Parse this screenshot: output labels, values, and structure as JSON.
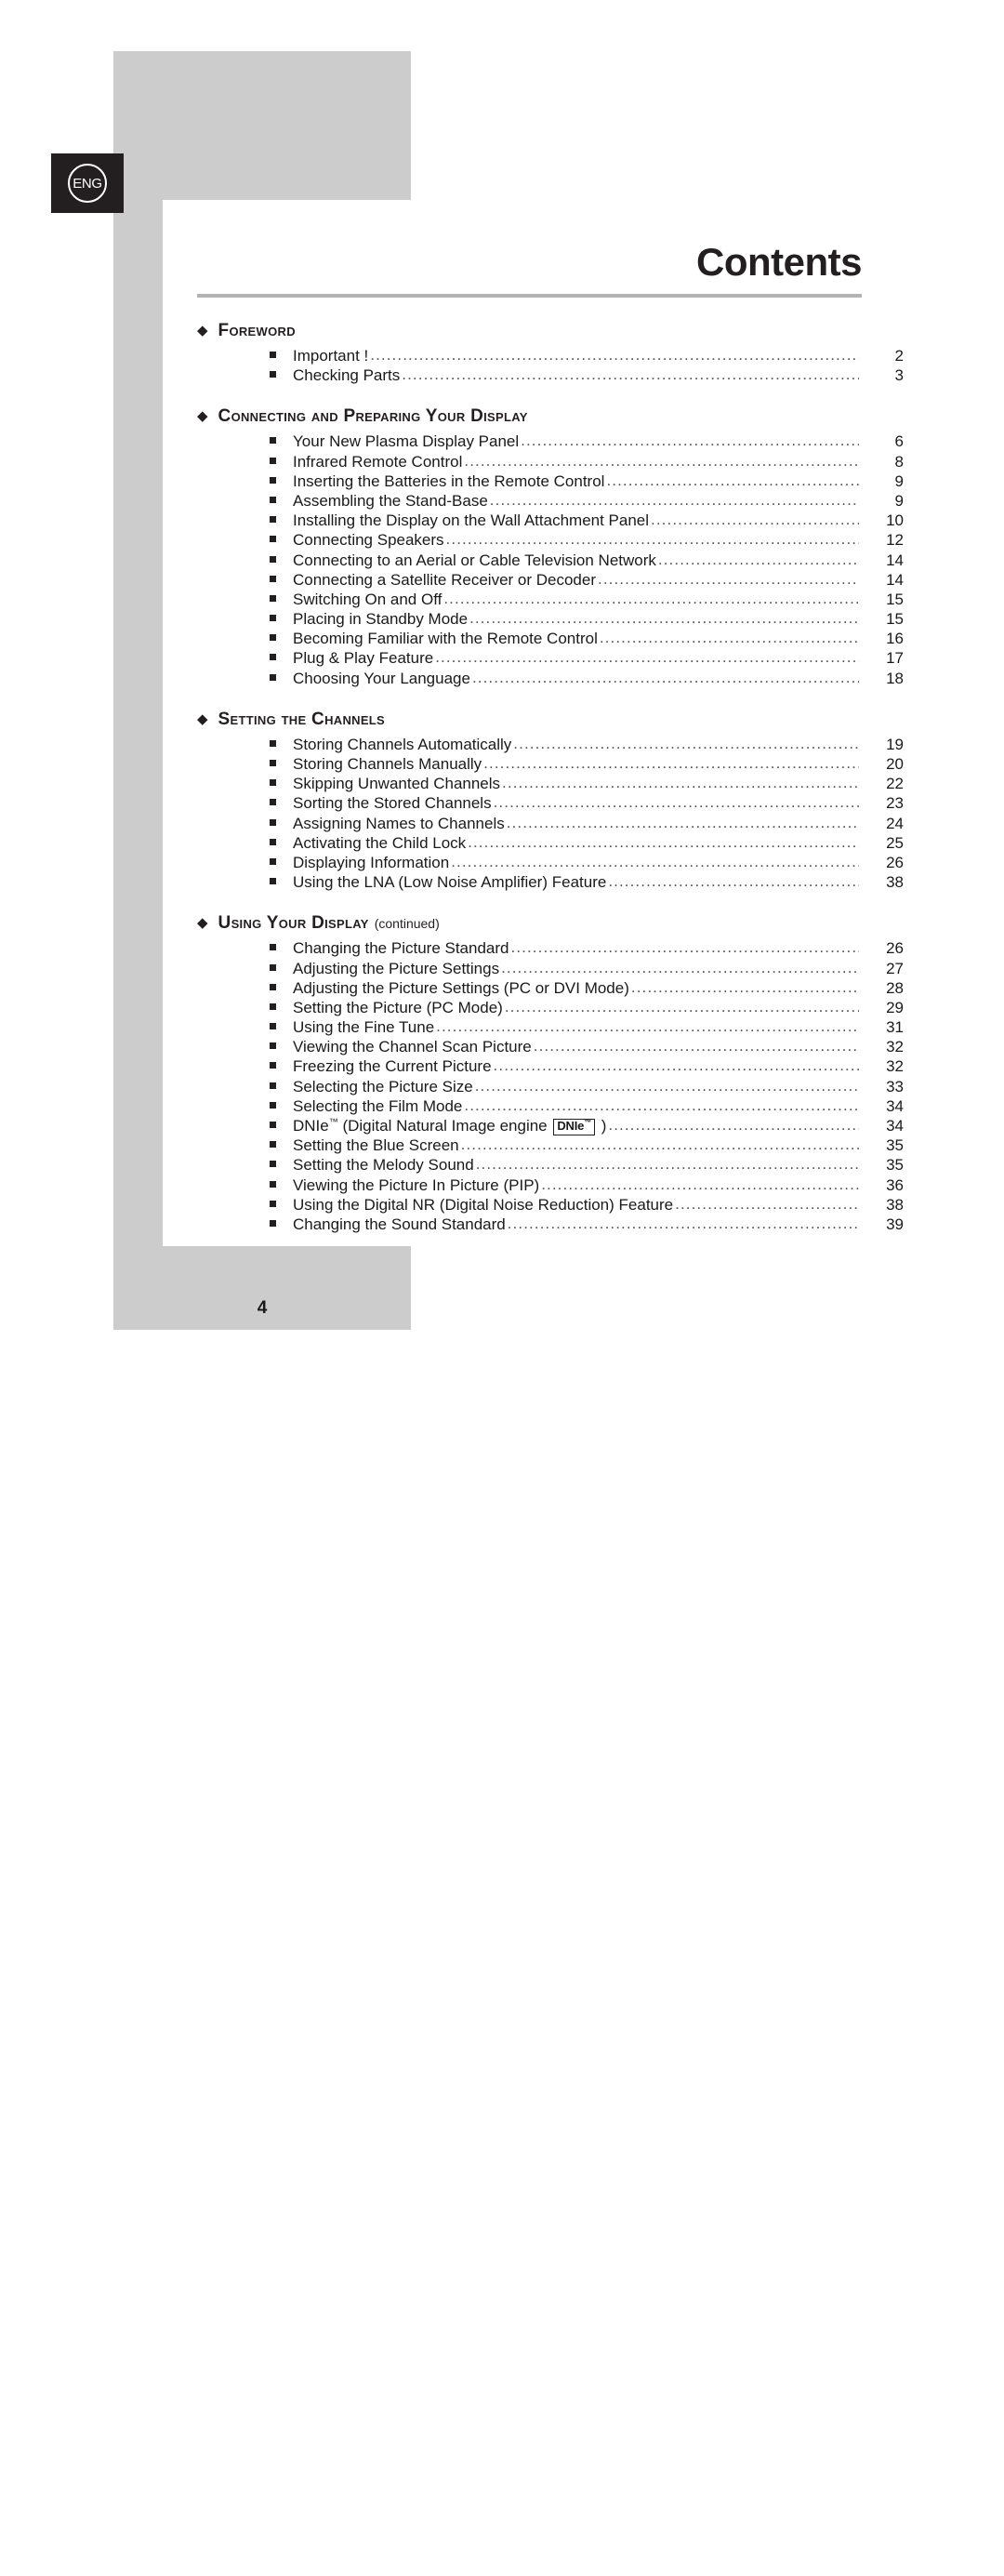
{
  "language_badge": {
    "label": "ENG",
    "icon": "circled-eng-icon"
  },
  "header": {
    "title": "Contents",
    "page_number": "4"
  },
  "icons": {
    "section_bullet": "◆",
    "item_bullet": "square-bullet-icon",
    "leader": "............................................................................................................................."
  },
  "toc": {
    "sections": [
      {
        "title": "Foreword",
        "suffix": "",
        "items": [
          {
            "label": "Important !",
            "page": "2"
          },
          {
            "label": "Checking Parts",
            "page": "3"
          }
        ]
      },
      {
        "title": "Connecting and Preparing Your Display",
        "suffix": "",
        "items": [
          {
            "label": "Your New Plasma Display Panel",
            "page": "6"
          },
          {
            "label": "Infrared Remote Control",
            "page": "8"
          },
          {
            "label": "Inserting the Batteries in the Remote Control",
            "page": "9"
          },
          {
            "label": "Assembling the Stand-Base",
            "page": "9"
          },
          {
            "label": "Installing the Display on the Wall Attachment Panel",
            "page": "10"
          },
          {
            "label": "Connecting Speakers",
            "page": "12"
          },
          {
            "label": "Connecting to an Aerial or Cable Television Network",
            "page": "14"
          },
          {
            "label": "Connecting a Satellite Receiver or Decoder",
            "page": "14"
          },
          {
            "label": "Switching On and Off",
            "page": "15"
          },
          {
            "label": "Placing in Standby Mode",
            "page": "15"
          },
          {
            "label": "Becoming Familiar with the Remote Control",
            "page": "16"
          },
          {
            "label": "Plug & Play Feature",
            "page": "17"
          },
          {
            "label": "Choosing Your Language",
            "page": "18"
          }
        ]
      },
      {
        "title": "Setting the Channels",
        "suffix": "",
        "items": [
          {
            "label": "Storing Channels Automatically",
            "page": "19"
          },
          {
            "label": "Storing Channels Manually",
            "page": "20"
          },
          {
            "label": "Skipping Unwanted Channels",
            "page": "22"
          },
          {
            "label": "Sorting the Stored Channels",
            "page": "23"
          },
          {
            "label": "Assigning Names to Channels",
            "page": "24"
          },
          {
            "label": "Activating the Child Lock",
            "page": "25"
          },
          {
            "label": "Displaying Information",
            "page": "26"
          },
          {
            "label": "Using the LNA (Low Noise Amplifier) Feature",
            "page": "38"
          }
        ]
      },
      {
        "title": "Using Your Display",
        "suffix": "(continued)",
        "items": [
          {
            "label": "Changing the Picture Standard",
            "page": "26"
          },
          {
            "label": "Adjusting the Picture Settings",
            "page": "27"
          },
          {
            "label": "Adjusting the Picture Settings (PC or DVI Mode)",
            "page": "28"
          },
          {
            "label": "Setting the Picture (PC Mode)",
            "page": "29"
          },
          {
            "label": "Using the Fine Tune",
            "page": "31"
          },
          {
            "label": "Viewing the Channel Scan Picture",
            "page": "32"
          },
          {
            "label": "Freezing the Current Picture",
            "page": "32"
          },
          {
            "label": "Selecting the Picture Size",
            "page": "33"
          },
          {
            "label": "Selecting the Film Mode",
            "page": "34"
          },
          {
            "label": "DNIe™ (Digital Natural Image engine DNIe™ )",
            "page": "34",
            "rich": {
              "pre": "DNIe",
              "tm1": "™",
              "mid": " (Digital Natural Image engine ",
              "badge": "DNIe",
              "badge_tm": "™",
              "post": " )"
            }
          },
          {
            "label": "Setting the Blue Screen",
            "page": "35"
          },
          {
            "label": "Setting the Melody Sound",
            "page": "35"
          },
          {
            "label": "Viewing the Picture In Picture (PIP)",
            "page": "36"
          },
          {
            "label": "Using the Digital NR (Digital Noise Reduction) Feature",
            "page": "38"
          },
          {
            "label": "Changing the Sound Standard",
            "page": "39"
          }
        ]
      }
    ]
  },
  "colors": {
    "frame_gray": "#cccccc",
    "badge_dark": "#231f20",
    "rule_gray": "#b3b3b3",
    "text": "#1a1a1a"
  }
}
